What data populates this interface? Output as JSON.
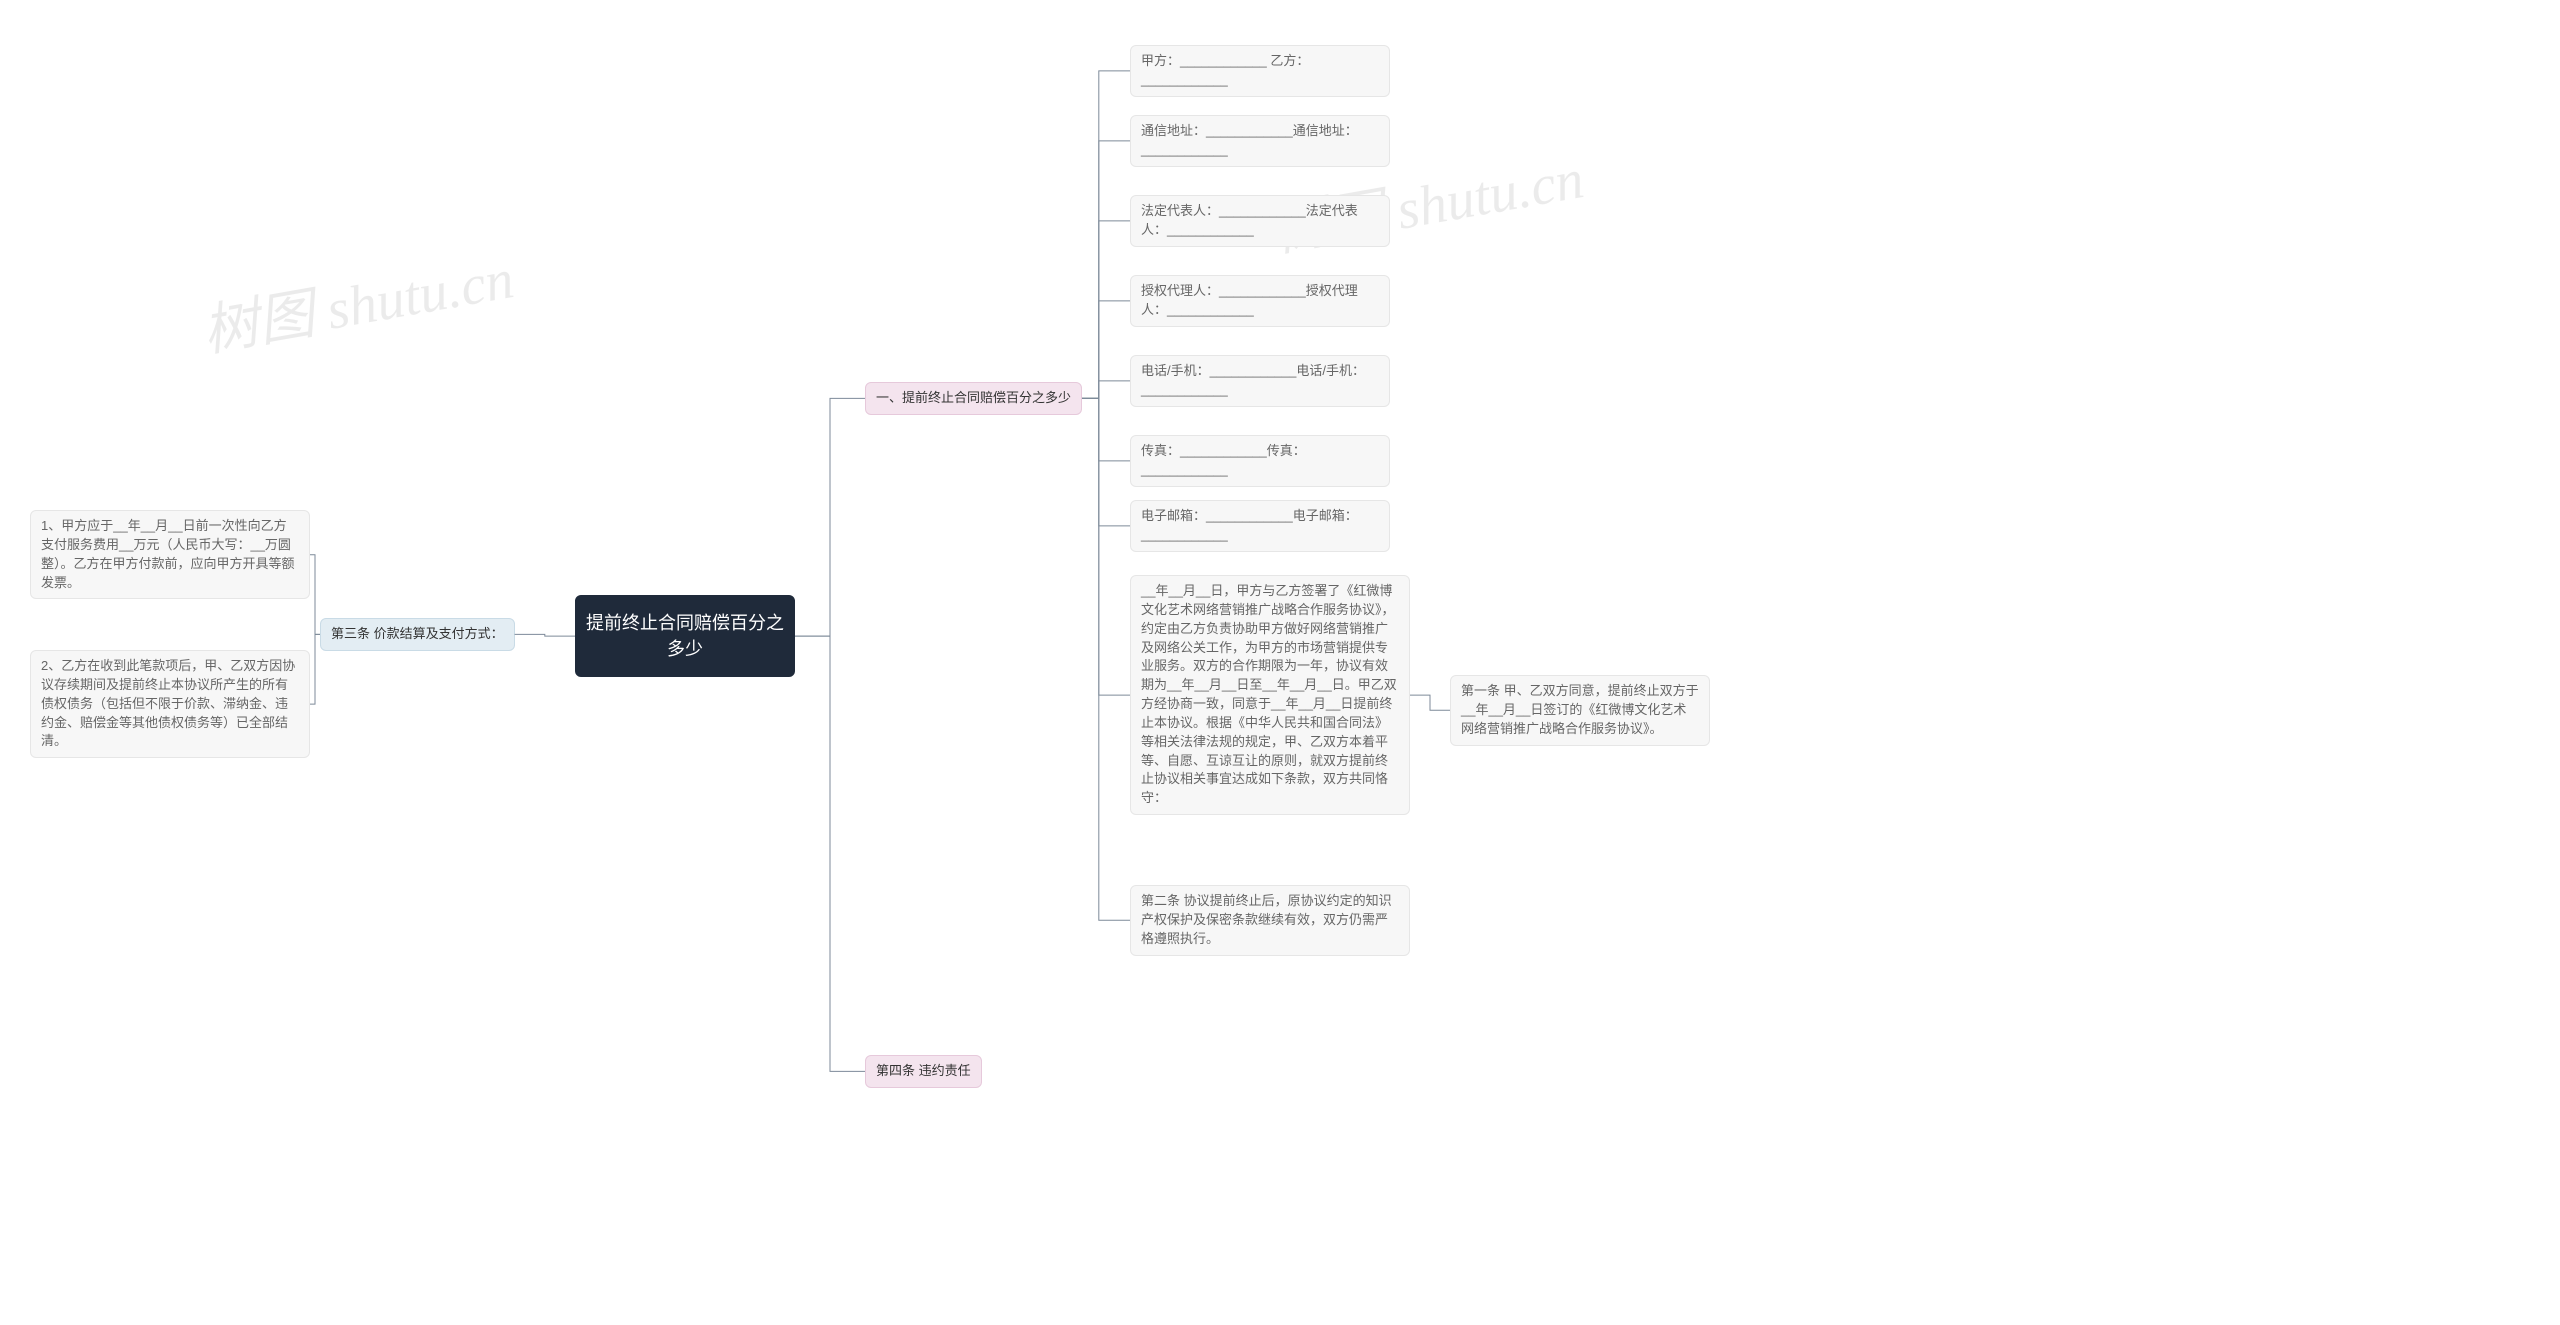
{
  "watermark": "树图 shutu.cn",
  "root": {
    "label": "提前终止合同赔偿百分之多少"
  },
  "branches": {
    "left": {
      "label": "第三条 价款结算及支付方式：",
      "leaves": [
        {
          "text": "1、甲方应于__年__月__日前一次性向乙方支付服务费用__万元（人民币大写：__万圆整）。乙方在甲方付款前，应向甲方开具等额发票。"
        },
        {
          "text": "2、乙方在收到此笔款项后，甲、乙双方因协议存续期间及提前终止本协议所产生的所有债权债务（包括但不限于价款、滞纳金、违约金、赔偿金等其他债权债务等）已全部结清。"
        }
      ]
    },
    "right1": {
      "label": "一、提前终止合同赔偿百分之多少",
      "leaves": [
        {
          "text": "甲方：____________ 乙方：____________"
        },
        {
          "text": "通信地址：____________通信地址：____________"
        },
        {
          "text": "法定代表人：____________法定代表人：____________"
        },
        {
          "text": "授权代理人：____________授权代理人：____________"
        },
        {
          "text": "电话/手机：____________电话/手机：____________"
        },
        {
          "text": "传真：____________传真：____________"
        },
        {
          "text": "电子邮箱：____________电子邮箱：____________"
        },
        {
          "text": "__年__月__日，甲方与乙方签署了《红微博文化艺术网络营销推广战略合作服务协议》，约定由乙方负责协助甲方做好网络营销推广及网络公关工作，为甲方的市场营销提供专业服务。双方的合作期限为一年，协议有效期为__年__月__日至__年__月__日。甲乙双方经协商一致，同意于__年__月__日提前终止本协议。根据《中华人民共和国合同法》等相关法律法规的规定，甲、乙双方本着平等、自愿、互谅互让的原则，就双方提前终止协议相关事宜达成如下条款，双方共同恪守：",
          "child": {
            "text": "第一条 甲、乙双方同意，提前终止双方于__年__月__日签订的《红微博文化艺术网络营销推广战略合作服务协议》。"
          }
        },
        {
          "text": "第二条 协议提前终止后，原协议约定的知识产权保护及保密条款继续有效，双方仍需严格遵照执行。"
        }
      ]
    },
    "right2": {
      "label": "第四条 违约责任"
    }
  }
}
